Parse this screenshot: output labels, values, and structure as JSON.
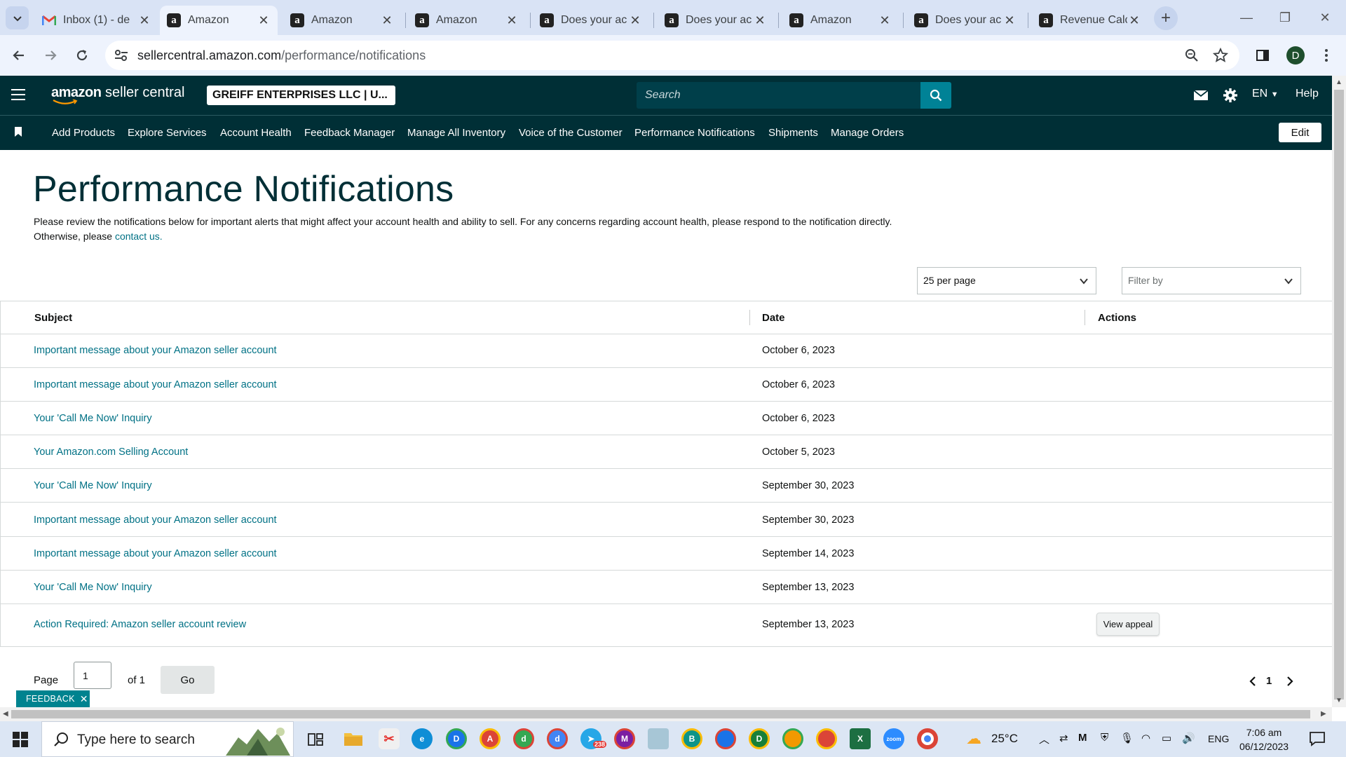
{
  "browser": {
    "tabs": [
      {
        "title": "Inbox (1) - de",
        "favicon": "gmail-icon"
      },
      {
        "title": "Amazon",
        "favicon": "amazon-icon",
        "active": true
      },
      {
        "title": "Amazon",
        "favicon": "amazon-icon"
      },
      {
        "title": "Amazon",
        "favicon": "amazon-icon"
      },
      {
        "title": "Does your ac",
        "favicon": "amazon-icon"
      },
      {
        "title": "Does your ac",
        "favicon": "amazon-icon"
      },
      {
        "title": "Amazon",
        "favicon": "amazon-icon"
      },
      {
        "title": "Does your ac",
        "favicon": "amazon-icon"
      },
      {
        "title": "Revenue Calc",
        "favicon": "amazon-icon"
      }
    ],
    "url_host": "sellercentral.amazon.com",
    "url_path": "/performance/notifications",
    "profile_initial": "D"
  },
  "header": {
    "logo_brand": "amazon",
    "logo_product": " seller central",
    "account": "GREIFF ENTERPRISES LLC | U...",
    "search_placeholder": "Search",
    "language": "EN",
    "help": "Help"
  },
  "nav": {
    "items": [
      "Add Products",
      "Explore Services",
      "Account Health",
      "Feedback Manager",
      "Manage All Inventory",
      "Voice of the Customer",
      "Performance Notifications",
      "Shipments",
      "Manage Orders"
    ],
    "edit_label": "Edit"
  },
  "page": {
    "title": "Performance Notifications",
    "intro_text": "Please review the notifications below for important alerts that might affect your account health and ability to sell. For any concerns regarding account health, please respond to the notification directly. Otherwise, please ",
    "intro_link": "contact us."
  },
  "controls": {
    "per_page": "25 per page",
    "filter_placeholder": "Filter by"
  },
  "table": {
    "headers": {
      "subject": "Subject",
      "date": "Date",
      "actions": "Actions"
    },
    "rows": [
      {
        "subject": "Important message about your Amazon seller account",
        "date": "October 6, 2023",
        "action": ""
      },
      {
        "subject": "Important message about your Amazon seller account",
        "date": "October 6, 2023",
        "action": ""
      },
      {
        "subject": "Your 'Call Me Now' Inquiry",
        "date": "October 6, 2023",
        "action": ""
      },
      {
        "subject": "Your Amazon.com Selling Account",
        "date": "October 5, 2023",
        "action": ""
      },
      {
        "subject": "Your 'Call Me Now' Inquiry",
        "date": "September 30, 2023",
        "action": ""
      },
      {
        "subject": "Important message about your Amazon seller account",
        "date": "September 30, 2023",
        "action": ""
      },
      {
        "subject": "Important message about your Amazon seller account",
        "date": "September 14, 2023",
        "action": ""
      },
      {
        "subject": "Your 'Call Me Now' Inquiry",
        "date": "September 13, 2023",
        "action": ""
      },
      {
        "subject": "Action Required: Amazon seller account review",
        "date": "September 13, 2023",
        "action": "View appeal"
      }
    ]
  },
  "pagination": {
    "page_label": "Page",
    "page_value": "1",
    "of_label": "of 1",
    "go_label": "Go",
    "current_page": "1"
  },
  "feedback_label": "FEEDBACK",
  "taskbar": {
    "search_placeholder": "Type here to search",
    "temperature": "25°C",
    "language": "ENG",
    "time": "7:06 am",
    "date": "06/12/2023",
    "telegram_badge": "238"
  },
  "colors": {
    "header_bg": "#002f36",
    "link": "#007185",
    "search_button": "#008296",
    "feedback_bg": "#00838f"
  }
}
